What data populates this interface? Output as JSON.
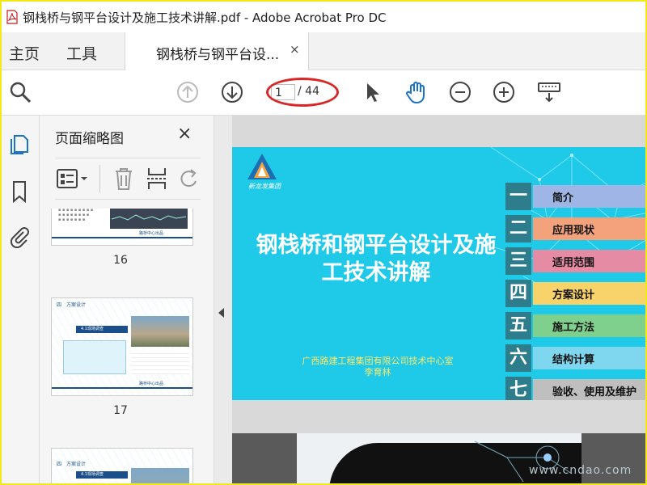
{
  "window": {
    "title": "钢栈桥与钢平台设计及施工技术讲解.pdf - Adobe Acrobat Pro DC"
  },
  "menu": {
    "home": "主页",
    "tools": "工具"
  },
  "tab": {
    "label": "钢栈桥与钢平台设...",
    "close": "×"
  },
  "toolbar": {
    "current_page": "1",
    "total_pages": "/ 44"
  },
  "thumbnail_panel": {
    "title": "页面缩略图",
    "close": "×",
    "thumbs": [
      {
        "page": "16",
        "footer": "路桥中心出品"
      },
      {
        "page": "17",
        "header": "四　方案设计",
        "section": "4.1现场调查",
        "footer": "路桥中心出品"
      },
      {
        "header": "四　方案设计",
        "section": "4.1现场调查"
      }
    ]
  },
  "slide": {
    "title_line1": "钢栈桥和钢平台设计及施",
    "title_line2": "工技术讲解",
    "organization": "广西路建工程集团有限公司技术中心室",
    "author": "李育林",
    "logo_text": "新龙发集团",
    "toc": [
      {
        "num": "一",
        "label": "简介",
        "color": "#9fb5e6"
      },
      {
        "num": "二",
        "label": "应用现状",
        "color": "#f3a27c"
      },
      {
        "num": "三",
        "label": "适用范围",
        "color": "#e58ca4"
      },
      {
        "num": "四",
        "label": "方案设计",
        "color": "#f7d36a"
      },
      {
        "num": "五",
        "label": "施工方法",
        "color": "#7fd08c"
      },
      {
        "num": "六",
        "label": "结构计算",
        "color": "#7fd7ef"
      },
      {
        "num": "七",
        "label": "验收、使用及维护",
        "color": "#bfbfbf"
      }
    ]
  },
  "watermark": "www.cndao.com",
  "colors": {
    "accent": "#1fc9e8",
    "highlight": "#d92626",
    "frame": "#f0ea1c",
    "toc_number_bg": "#2d7d8c"
  }
}
